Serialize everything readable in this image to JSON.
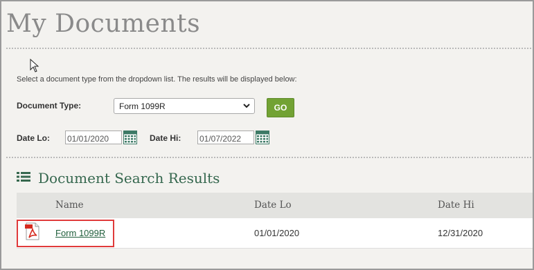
{
  "page": {
    "title": "My Documents"
  },
  "instructions": "Select a document type from the dropdown list. The results will be displayed below:",
  "form": {
    "doc_type_label": "Document Type:",
    "doc_type_value": "Form 1099R",
    "go_label": "GO",
    "date_lo_label": "Date Lo:",
    "date_lo_value": "01/01/2020",
    "date_hi_label": "Date Hi:",
    "date_hi_value": "01/07/2022"
  },
  "results": {
    "title": "Document Search Results",
    "columns": [
      "Name",
      "Date Lo",
      "Date Hi"
    ],
    "rows": [
      {
        "name": "Form 1099R",
        "date_lo": "01/01/2020",
        "date_hi": "12/31/2020",
        "icon": "pdf-icon"
      }
    ]
  },
  "colors": {
    "accent_green": "#72a234",
    "heading_green": "#35674e",
    "highlight_red": "#e03a3a"
  }
}
